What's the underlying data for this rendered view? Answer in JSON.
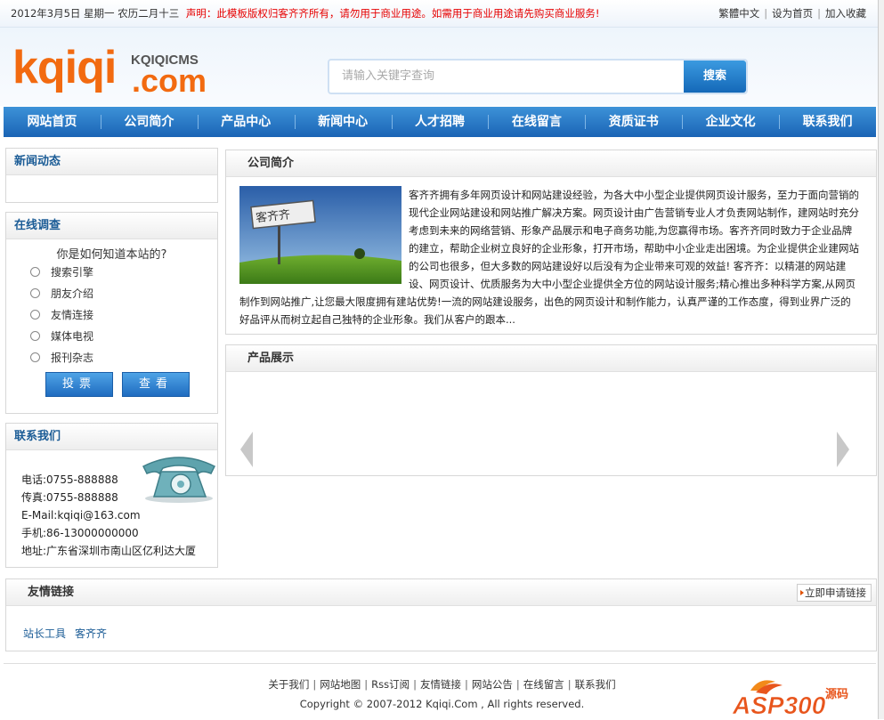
{
  "topbar": {
    "date": "2012年3月5日 星期一 农历二月十三",
    "notice": "声明：此模板版权归客齐齐所有，请勿用于商业用途。如需用于商业用途请先购买商业服务!",
    "links": [
      "繁體中文",
      "设为首页",
      "加入收藏"
    ]
  },
  "logo": {
    "main": "kqiqi",
    "small": "KQIQICMS",
    "suffix": ".com"
  },
  "search": {
    "placeholder": "请输入关键字查询",
    "button": "搜索"
  },
  "nav": [
    "网站首页",
    "公司简介",
    "产品中心",
    "新闻中心",
    "人才招聘",
    "在线留言",
    "资质证书",
    "企业文化",
    "联系我们"
  ],
  "news": {
    "title": "新闻动态"
  },
  "survey": {
    "title": "在线调查",
    "question": "你是如何知道本站的?",
    "options": [
      "搜索引擎",
      "朋友介绍",
      "友情连接",
      "媒体电视",
      "报刊杂志"
    ],
    "vote": "投票",
    "view": "查看"
  },
  "contact": {
    "title": "联系我们",
    "lines": [
      "电话:0755-888888",
      "传真:0755-888888",
      "E-Mail:kqiqi@163.com",
      "手机:86-13000000000",
      "地址:广东省深圳市南山区亿利达大厦"
    ]
  },
  "about": {
    "title": "公司简介",
    "sign_text": "客齐齐",
    "body": "客齐齐拥有多年网页设计和网站建设经验，为各大中小型企业提供网页设计服务，至力于面向营销的现代企业网站建设和网站推广解决方案。网页设计由广告营销专业人才负责网站制作，建网站时充分考虑到未来的网络营销、形象产品展示和电子商务功能,为您赢得市场。客齐齐同时致力于企业品牌的建立，帮助企业树立良好的企业形象，打开市场，帮助中小企业走出困境。为企业提供企业建网站的公司也很多，但大多数的网站建设好以后没有为企业带来可观的效益! 客齐齐：以精湛的网站建设、网页设计、优质服务为大中小型企业提供全方位的网站设计服务;精心推出多种科学方案,从网页制作到网站推广,让您最大限度拥有建站优势!一流的网站建设服务，出色的网页设计和制作能力，认真严谨的工作态度，得到业界广泛的好品评从而树立起自己独特的企业形象。我们从客户的跟本..."
  },
  "products": {
    "title": "产品展示"
  },
  "links": {
    "title": "友情链接",
    "apply": "立即申请链接",
    "items": [
      "站长工具",
      "客齐齐"
    ]
  },
  "footer": {
    "links": [
      "关于我们",
      "网站地图",
      "Rss订阅",
      "友情链接",
      "网站公告",
      "在线留言",
      "联系我们"
    ],
    "copyright": "Copyright © 2007-2012 Kqiqi.Com , All rights reserved."
  },
  "watermark": {
    "brand": "ASP300",
    "sub": "源码"
  }
}
